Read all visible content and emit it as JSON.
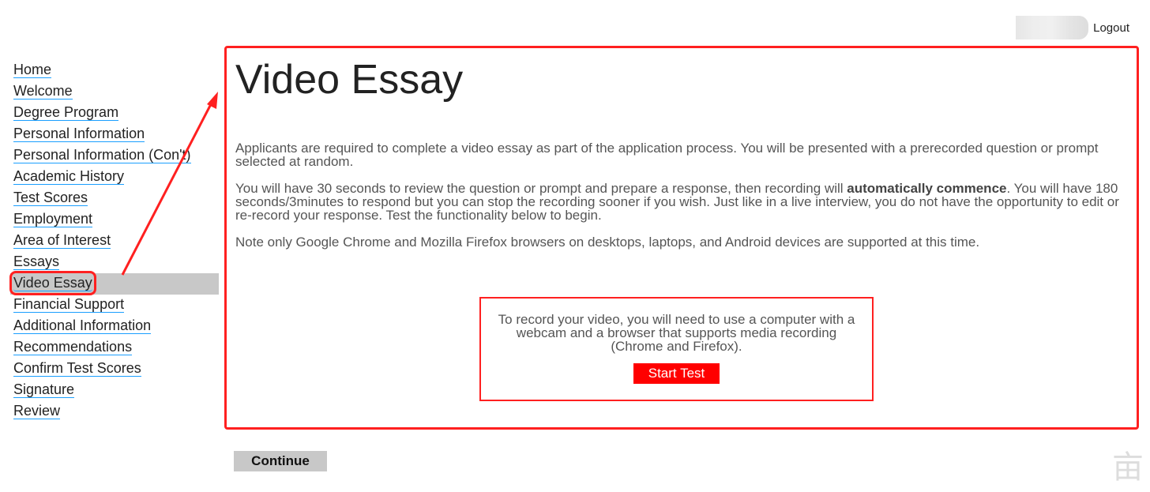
{
  "header": {
    "logout": "Logout"
  },
  "sidebar": {
    "items": [
      {
        "label": "Home"
      },
      {
        "label": "Welcome"
      },
      {
        "label": "Degree Program"
      },
      {
        "label": "Personal Information"
      },
      {
        "label": "Personal Information (Con't)"
      },
      {
        "label": "Academic History"
      },
      {
        "label": "Test Scores"
      },
      {
        "label": "Employment"
      },
      {
        "label": "Area of Interest"
      },
      {
        "label": "Essays"
      },
      {
        "label": "Video Essay",
        "active": true
      },
      {
        "label": "Financial Support"
      },
      {
        "label": "Additional Information"
      },
      {
        "label": "Recommendations"
      },
      {
        "label": "Confirm Test Scores"
      },
      {
        "label": "Signature"
      },
      {
        "label": "Review"
      }
    ]
  },
  "main": {
    "title": "Video Essay",
    "p1": "Applicants are required to complete a video essay as part of the application process. You will be presented with a prerecorded question or prompt selected at random.",
    "p2a": "You will have 30 seconds to review the question or prompt and prepare a response, then recording will ",
    "p2b": "automatically commence",
    "p2c": ". You will have 180 seconds/3minutes to respond but you can stop the recording sooner if you wish. Just like in a live interview, you do not have the opportunity to edit or re-record your response. Test the functionality below to begin.",
    "p3": "Note only Google Chrome and Mozilla Firefox browsers on desktops, laptops, and Android devices are supported at this time.",
    "record_note": "To record your video, you will need to use a computer with a webcam and a browser that supports media recording (Chrome and Firefox).",
    "start_test": "Start Test"
  },
  "continue": "Continue",
  "colors": {
    "annotation": "#ff2020",
    "start_button": "#ff0000",
    "link_underline": "#1a9fff",
    "active_bg": "#c8c8c8"
  }
}
